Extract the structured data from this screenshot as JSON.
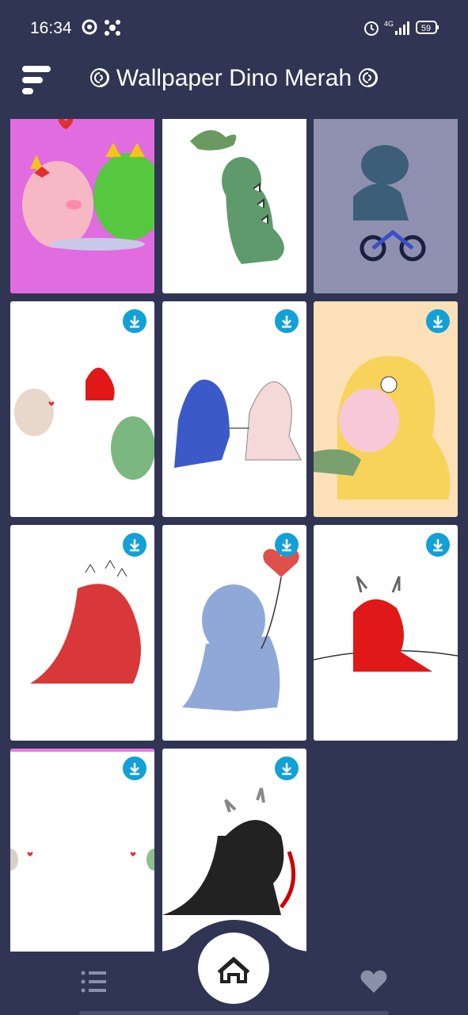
{
  "status": {
    "time": "16:34",
    "network": "4G",
    "battery": "59"
  },
  "appbar": {
    "title": "Wallpaper Dino Merah",
    "title_icon": "lollipop-swirl-icon"
  },
  "wallpapers": [
    {
      "subject": "pink and green dinos kissing",
      "has_download": false
    },
    {
      "subject": "green dino looking up",
      "has_download": false
    },
    {
      "subject": "dino riding bicycle",
      "has_download": false
    },
    {
      "subject": "red dino with two dinos",
      "has_download": true
    },
    {
      "subject": "blue and pink dinos holding hands",
      "has_download": true
    },
    {
      "subject": "yellow dino costume",
      "has_download": true
    },
    {
      "subject": "angry red dino",
      "has_download": true
    },
    {
      "subject": "blue dino with heart balloon",
      "has_download": true
    },
    {
      "subject": "red dino on wire",
      "has_download": true
    },
    {
      "subject": "dinos on edges",
      "has_download": true
    },
    {
      "subject": "black dino with scythe",
      "has_download": true
    }
  ],
  "nav": {
    "list": "list-icon",
    "home": "home-icon",
    "favorites": "heart-icon"
  },
  "colors": {
    "background": "#2f3552",
    "accent": "#12a0d6"
  }
}
